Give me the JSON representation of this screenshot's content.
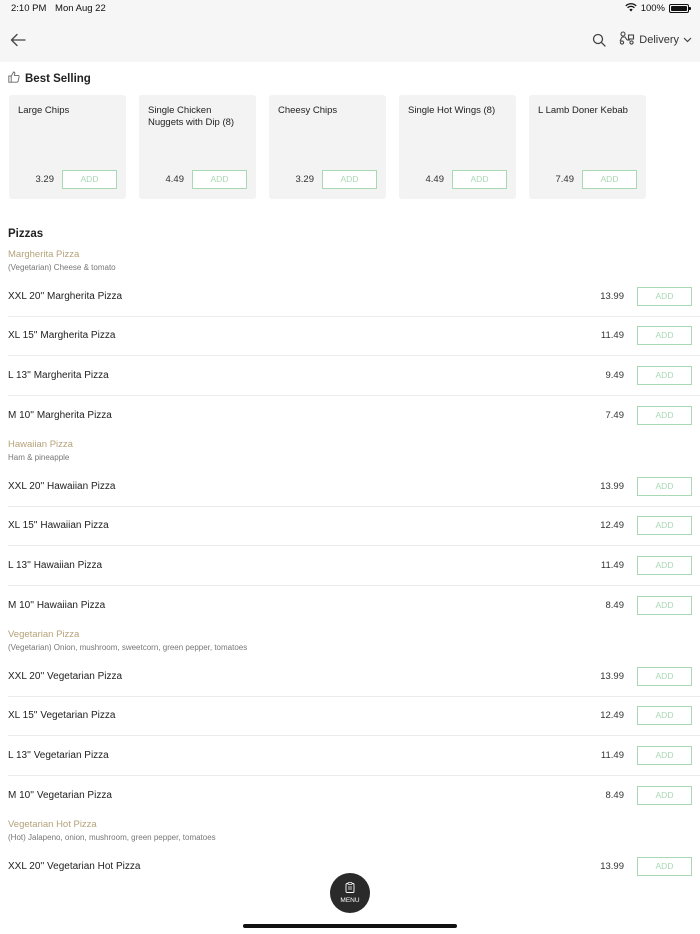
{
  "status": {
    "time": "2:10 PM",
    "date": "Mon Aug 22",
    "battery": "100%",
    "battery_level": 1.0
  },
  "nav": {
    "delivery_label": "Delivery"
  },
  "best_selling": {
    "title": "Best Selling",
    "add_label": "ADD",
    "items": [
      {
        "name": "Large Chips",
        "price": "3.29"
      },
      {
        "name": "Single Chicken Nuggets with Dip (8)",
        "price": "4.49"
      },
      {
        "name": "Cheesy Chips",
        "price": "3.29"
      },
      {
        "name": "Single Hot Wings (8)",
        "price": "4.49"
      },
      {
        "name": "L Lamb Doner Kebab",
        "price": "7.49"
      }
    ]
  },
  "menu": {
    "section_title": "Pizzas",
    "add_label": "ADD",
    "groups": [
      {
        "name": "Margherita Pizza",
        "description": "(Vegetarian) Cheese & tomato",
        "items": [
          {
            "name": "XXL 20'' Margherita Pizza",
            "price": "13.99"
          },
          {
            "name": "XL 15'' Margherita Pizza",
            "price": "11.49"
          },
          {
            "name": "L 13'' Margherita Pizza",
            "price": "9.49"
          },
          {
            "name": "M 10'' Margherita Pizza",
            "price": "7.49"
          }
        ]
      },
      {
        "name": "Hawaiian Pizza",
        "description": "Ham & pineapple",
        "items": [
          {
            "name": "XXL 20'' Hawaiian Pizza",
            "price": "13.99"
          },
          {
            "name": "XL 15'' Hawaiian Pizza",
            "price": "12.49"
          },
          {
            "name": "L 13'' Hawaiian Pizza",
            "price": "11.49"
          },
          {
            "name": "M 10'' Hawaiian Pizza",
            "price": "8.49"
          }
        ]
      },
      {
        "name": "Vegetarian Pizza",
        "description": "(Vegetarian) Onion, mushroom, sweetcorn, green pepper, tomatoes",
        "items": [
          {
            "name": "XXL 20'' Vegetarian Pizza",
            "price": "13.99"
          },
          {
            "name": "XL 15'' Vegetarian Pizza",
            "price": "12.49"
          },
          {
            "name": "L 13'' Vegetarian Pizza",
            "price": "11.49"
          },
          {
            "name": "M 10'' Vegetarian Pizza",
            "price": "8.49"
          }
        ]
      },
      {
        "name": "Vegetarian Hot Pizza",
        "description": "(Hot) Jalapeno, onion, mushroom, green pepper, tomatoes",
        "items": [
          {
            "name": "XXL 20'' Vegetarian Hot Pizza",
            "price": "13.99"
          }
        ]
      }
    ]
  },
  "fab": {
    "label": "MENU"
  },
  "colors": {
    "accent_green": "#a9d8b4",
    "group_gold": "#b5a27a",
    "fab_dark": "#2a2a2a",
    "bar_bg": "#f6f6f6"
  }
}
